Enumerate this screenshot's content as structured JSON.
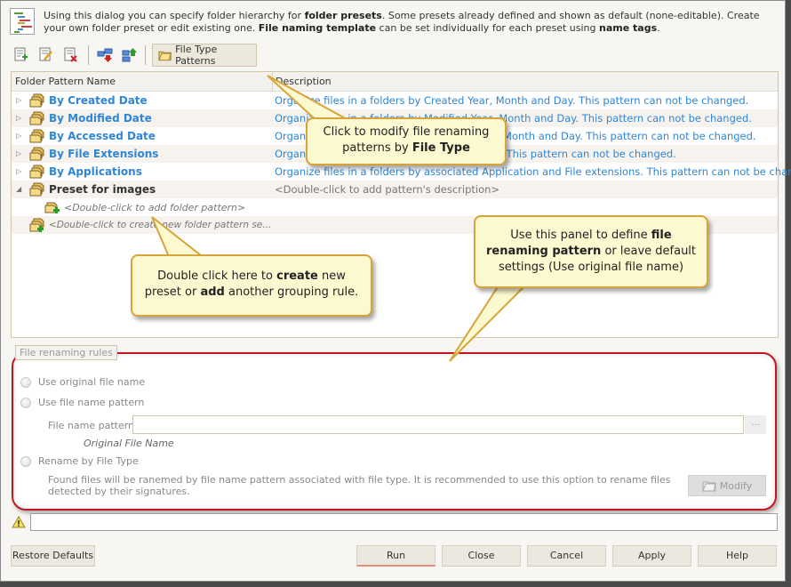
{
  "info": {
    "parts": [
      {
        "text": "Using this dialog you can specify folder hierarchy for ",
        "bold": false
      },
      {
        "text": "folder presets",
        "bold": true
      },
      {
        "text": ". Some presets already defined and shown as default (none-editable). Create your own folder preset or edit existing one. ",
        "bold": false
      },
      {
        "text": "File naming template",
        "bold": true
      },
      {
        "text": " can be set individually for each preset using ",
        "bold": false
      },
      {
        "text": "name tags",
        "bold": true
      },
      {
        "text": ".",
        "bold": false
      }
    ],
    "icon": "hierarchy-list-icon"
  },
  "toolbar": {
    "buttons": [
      {
        "name": "add-preset-button",
        "icon": "add-document-icon"
      },
      {
        "name": "edit-preset-button",
        "icon": "edit-document-icon"
      },
      {
        "name": "delete-preset-button",
        "icon": "delete-document-icon"
      },
      {
        "name": "move-down-button",
        "icon": "move-down-icon"
      },
      {
        "name": "move-up-button",
        "icon": "move-up-icon"
      }
    ],
    "file_type_patterns_label": "File Type Patterns"
  },
  "tree": {
    "columns": [
      "Folder Pattern Name",
      "Description"
    ],
    "rows": [
      {
        "name": "By Created Date",
        "description": "Organize files in a folders by Created Year, Month and Day. This pattern can not be changed.",
        "expanded": false,
        "default": true
      },
      {
        "name": "By Modified Date",
        "description": "Organize files in a folders by Modified Year, Month and Day. This pattern can not be changed.",
        "expanded": false,
        "default": true
      },
      {
        "name": "By Accessed Date",
        "description": "Organize files in a folders by Accessed Year, Month and Day. This pattern can not be changed.",
        "expanded": false,
        "default": true
      },
      {
        "name": "By File Extensions",
        "description": "Organize files in a folders by File Extensions. This pattern can not be changed.",
        "expanded": false,
        "default": true
      },
      {
        "name": "By Applications",
        "description": "Organize files in a folders by associated Application and File extensions. This pattern can not be changed.",
        "expanded": false,
        "default": true
      },
      {
        "name": "Preset for images",
        "description": "<Double-click to add pattern's description>",
        "expanded": true,
        "default": false
      }
    ],
    "add_folder_pattern_hint": "<Double-click to add folder pattern>",
    "create_preset_hint": "<Double-click to create new folder pattern se..."
  },
  "callouts": {
    "file_type": {
      "line1": "Click to modify file renaming",
      "line2_pre": "patterns by ",
      "line2_bold": "File Type"
    },
    "create": {
      "l1_pre": "Double click here to ",
      "l1_bold": "create",
      "l1_post": " new",
      "l2_pre": "preset or ",
      "l2_bold": "add",
      "l2_post": " another grouping rule."
    },
    "panel": {
      "l1_pre": "Use this panel to define ",
      "l1_bold": "file",
      "l2_bold": "renaming pattern",
      "l2_post": " or leave default",
      "l3": "settings (Use original file name)"
    }
  },
  "rules": {
    "legend": "File renaming rules",
    "options": [
      "Use original file name",
      "Use file name pattern",
      "Rename by File Type"
    ],
    "pattern_label": "File name pattern:",
    "pattern_value": "",
    "browse_label": "...",
    "pattern_preview": "Original File Name",
    "found_text": "Found files will be ranemed by file name pattern associated with file type. It is recommended to use this option to rename files detected by their signatures.",
    "modify_label": "Modify"
  },
  "status": {
    "message": "",
    "icon": "warning-icon"
  },
  "buttons": {
    "restore": "Restore Defaults",
    "run": "Run",
    "close": "Close",
    "cancel": "Cancel",
    "apply": "Apply",
    "help": "Help"
  },
  "colors": {
    "link": "#2f86d6",
    "highlight_border": "#c0181e",
    "callout_bg": "#fcf9d0",
    "callout_border": "#d8a43a"
  }
}
